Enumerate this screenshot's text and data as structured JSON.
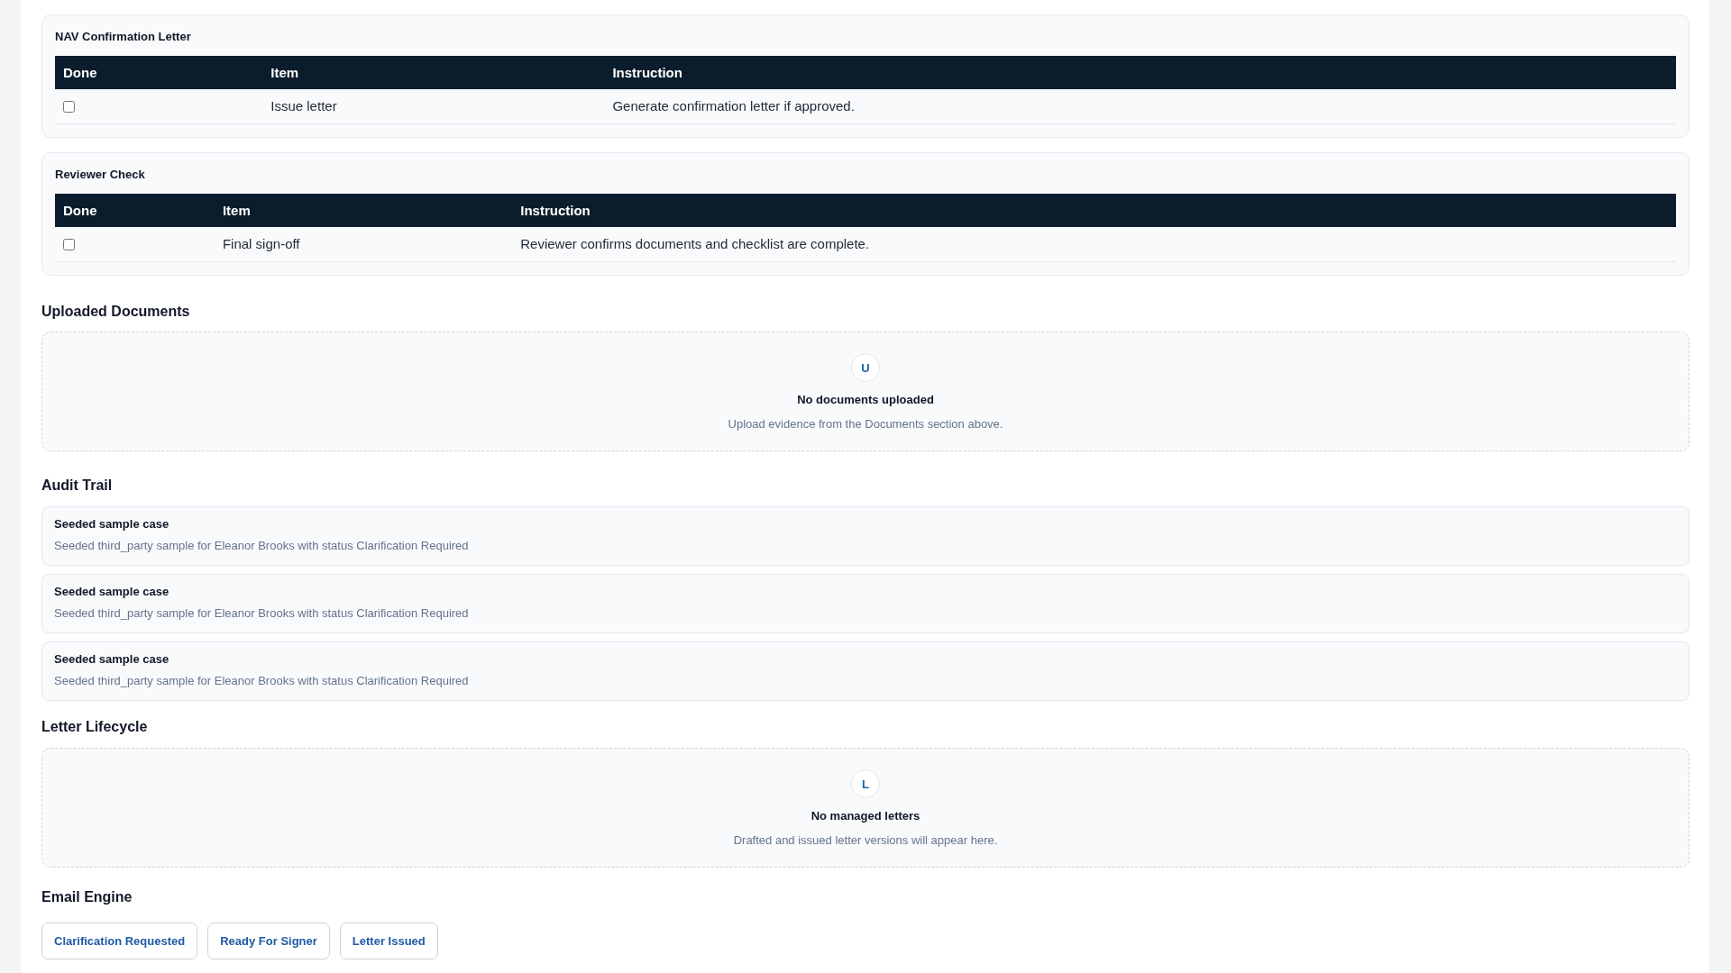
{
  "checklists": [
    {
      "title": "NAV Confirmation Letter",
      "columns": [
        "Done",
        "Item",
        "Instruction"
      ],
      "rows": [
        {
          "done": false,
          "item": "Issue letter",
          "instruction": "Generate confirmation letter if approved."
        }
      ]
    },
    {
      "title": "Reviewer Check",
      "columns": [
        "Done",
        "Item",
        "Instruction"
      ],
      "rows": [
        {
          "done": false,
          "item": "Final sign-off",
          "instruction": "Reviewer confirms documents and checklist are complete."
        }
      ]
    }
  ],
  "uploaded_documents": {
    "heading": "Uploaded Documents",
    "empty_state": {
      "initial": "U",
      "title": "No documents uploaded",
      "message": "Upload evidence from the Documents section above."
    }
  },
  "audit_trail": {
    "heading": "Audit Trail",
    "entries": [
      {
        "title": "Seeded sample case",
        "detail": "Seeded third_party sample for Eleanor Brooks with status Clarification Required"
      },
      {
        "title": "Seeded sample case",
        "detail": "Seeded third_party sample for Eleanor Brooks with status Clarification Required"
      },
      {
        "title": "Seeded sample case",
        "detail": "Seeded third_party sample for Eleanor Brooks with status Clarification Required"
      }
    ]
  },
  "letter_lifecycle": {
    "heading": "Letter Lifecycle",
    "empty_state": {
      "initial": "L",
      "title": "No managed letters",
      "message": "Drafted and issued letter versions will appear here."
    }
  },
  "email_engine": {
    "heading": "Email Engine",
    "buttons": [
      "Clarification Requested",
      "Ready For Signer",
      "Letter Issued"
    ]
  }
}
